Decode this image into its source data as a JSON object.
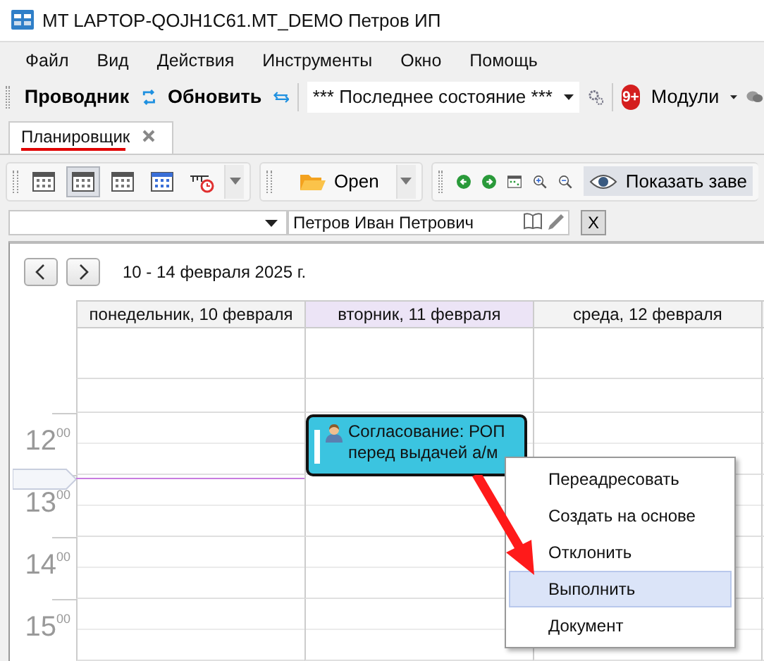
{
  "window": {
    "title": "MT LAPTOP-QOJH1C61.MT_DEMO Петров ИП"
  },
  "menu": [
    "Файл",
    "Вид",
    "Действия",
    "Инструменты",
    "Окно",
    "Помощь"
  ],
  "toolbar": {
    "explorer": "Проводник",
    "refresh": "Обновить",
    "state": "*** Последнее состояние ***",
    "badge": "9+",
    "modules": "Модули"
  },
  "tabs": [
    {
      "label": "Планировщик",
      "selected": true
    }
  ],
  "view_buttons": [
    {
      "kind": "day",
      "selected": false
    },
    {
      "kind": "workweek",
      "selected": true
    },
    {
      "kind": "week",
      "selected": false
    },
    {
      "kind": "month",
      "selected": false
    },
    {
      "kind": "timeline",
      "selected": false
    }
  ],
  "open_button": "Open",
  "show_button": {
    "label": "Показать заве",
    "selected": true
  },
  "filter": {
    "employee": "Петров Иван Петрович",
    "clear": "X"
  },
  "calendar": {
    "range": "10 - 14 февраля 2025 г.",
    "days": [
      {
        "label": "понедельник, 10 февраля",
        "selected": false
      },
      {
        "label": "вторник, 11 февраля",
        "selected": true
      },
      {
        "label": "среда, 12 февраля",
        "selected": false
      }
    ],
    "hours": [
      "12$^{00}$",
      "13$^{00}$",
      "14$^{00}$",
      "15$^{00}$"
    ],
    "event": {
      "text": "Согласование: РОП перед выдачей а/м",
      "color": "#3bc4e0"
    }
  },
  "context_menu": [
    {
      "label": "Переадресовать",
      "selected": false
    },
    {
      "label": "Создать на основе",
      "selected": false
    },
    {
      "label": "Отклонить",
      "selected": false
    },
    {
      "label": "Выполнить",
      "selected": true
    },
    {
      "label": "Документ",
      "selected": false
    }
  ]
}
